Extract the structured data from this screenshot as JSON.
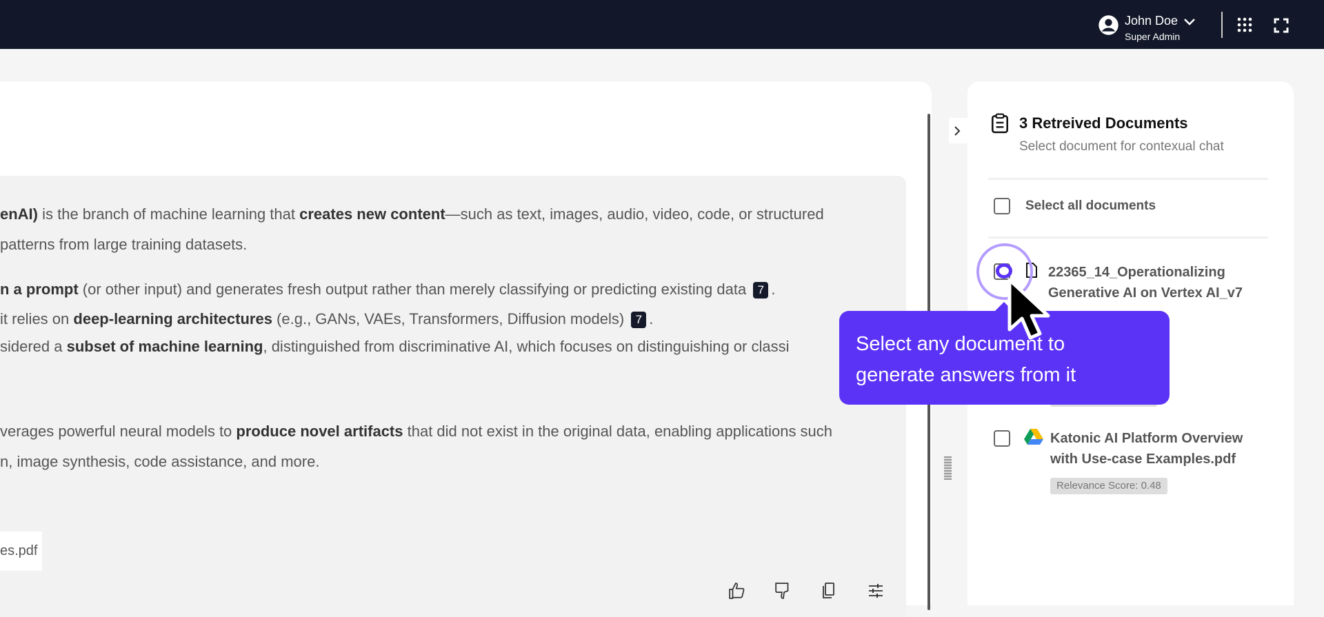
{
  "user": {
    "name": "John Doe",
    "role": "Super Admin"
  },
  "answer": {
    "lines": [
      [
        {
          "t": "enAI)",
          "b": true
        },
        {
          "t": " is the branch of machine learning that "
        },
        {
          "t": "creates new content",
          "b": true
        },
        {
          "t": "—such as text, images, audio, video, code, or structured"
        }
      ],
      [
        {
          "t": " patterns from large training datasets."
        }
      ],
      [
        {
          "t": "n a prompt",
          "b": true
        },
        {
          "t": " (or other input) and generates fresh output rather than merely classifying or predicting existing data "
        },
        {
          "t": "7",
          "c": true
        },
        {
          "t": "."
        }
      ],
      [
        {
          "t": "  it relies on "
        },
        {
          "t": "deep-learning architectures",
          "b": true
        },
        {
          "t": " (e.g., GANs, VAEs, Transformers, Diffusion models) "
        },
        {
          "t": "7",
          "c": true
        },
        {
          "t": "."
        }
      ],
      [
        {
          "t": "sidered a "
        },
        {
          "t": "subset of machine learning",
          "b": true
        },
        {
          "t": ", distinguished from discriminative AI, which focuses on distinguishing or classi"
        }
      ],
      [
        {
          "t": "verages powerful neural models to "
        },
        {
          "t": "produce novel artifacts",
          "b": true
        },
        {
          "t": " that did not exist in the original data, enabling applications such"
        }
      ],
      [
        {
          "t": "n, image synthesis, code assistance, and more."
        }
      ]
    ],
    "source_chip": "es.pdf"
  },
  "panel": {
    "title": "3 Retreived Documents",
    "subtitle": "Select document for contexual chat",
    "select_all": "Select all documents",
    "documents": [
      {
        "name": "22365_14_Operationalizing Generative AI on Vertex AI_v7"
      },
      {
        "name": "Katonic AI Platform Overview with Use-case Examples.pdf",
        "relevance": "Relevance Score: 0.48"
      }
    ]
  },
  "tooltip": {
    "text1": "Select any document to",
    "text2": "generate answers from it"
  },
  "colors": {
    "topbar": "#121829",
    "accent": "#5b33f7"
  }
}
